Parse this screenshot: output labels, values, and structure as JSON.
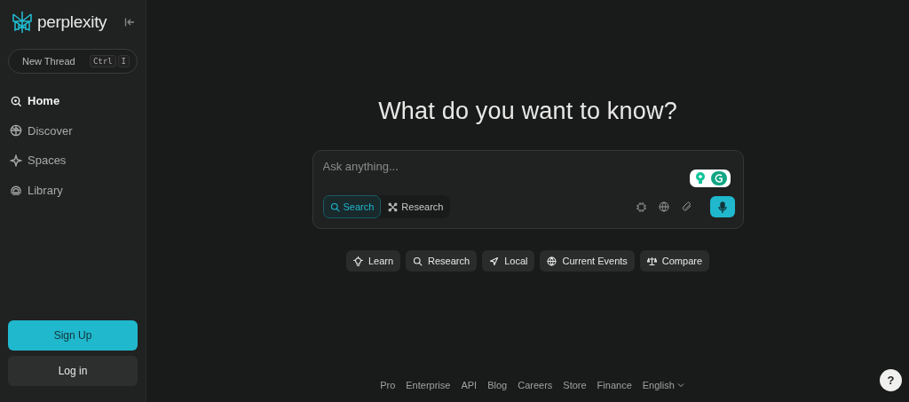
{
  "logo": {
    "text": "perplexity"
  },
  "new_thread": {
    "label": "New Thread",
    "keys": [
      "Ctrl",
      "I"
    ]
  },
  "nav": [
    {
      "label": "Home",
      "kind": "home",
      "selected": true
    },
    {
      "label": "Discover",
      "kind": "discover",
      "selected": false
    },
    {
      "label": "Spaces",
      "kind": "spaces",
      "selected": false
    },
    {
      "label": "Library",
      "kind": "library",
      "selected": false
    }
  ],
  "auth": {
    "sign_up": "Sign Up",
    "log_in": "Log in"
  },
  "heading": "What do you want to know?",
  "ask": {
    "placeholder": "Ask anything...",
    "modes": [
      {
        "label": "Search",
        "kind": "search",
        "selected": true
      },
      {
        "label": "Research",
        "kind": "research",
        "selected": false
      }
    ]
  },
  "suggestions": [
    {
      "label": "Learn",
      "kind": "learn"
    },
    {
      "label": "Research",
      "kind": "search"
    },
    {
      "label": "Local",
      "kind": "local"
    },
    {
      "label": "Current Events",
      "kind": "globe"
    },
    {
      "label": "Compare",
      "kind": "compare"
    }
  ],
  "footer": {
    "links": [
      "Pro",
      "Enterprise",
      "API",
      "Blog",
      "Careers",
      "Store",
      "Finance"
    ],
    "language": "English"
  },
  "help": "?"
}
